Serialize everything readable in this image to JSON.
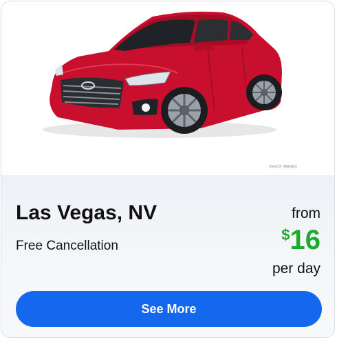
{
  "listing": {
    "image_credit": "©EVOX IMAGES",
    "location": "Las Vegas, NV",
    "cancellation": "Free Cancellation",
    "price_prefix": "from",
    "currency_symbol": "$",
    "price": "16",
    "price_suffix": "per day",
    "cta_label": "See More"
  },
  "colors": {
    "car_body": "#c8102e",
    "price": "#1faa2f",
    "button": "#1468ee"
  }
}
